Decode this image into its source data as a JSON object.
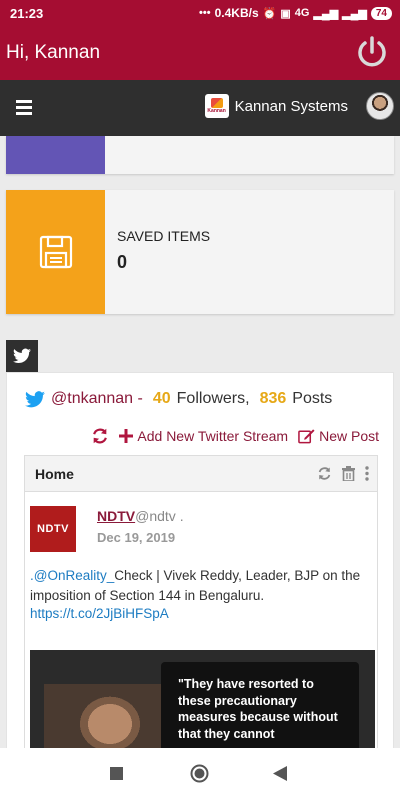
{
  "status_bar": {
    "time": "21:23",
    "net_speed": "0.4KB/s",
    "network": "4G",
    "battery": "74"
  },
  "app_bar": {
    "greeting": "Hi, Kannan",
    "power_icon": "power-icon"
  },
  "nav_bar": {
    "menu_icon": "hamburger-icon",
    "company_name": "Kannan Systems",
    "company_logo_text": "Kannan"
  },
  "saved_card": {
    "label": "SAVED ITEMS",
    "count": "0",
    "icon": "save-icon"
  },
  "twitter": {
    "handle": "@tnkannan -",
    "followers_count": "40",
    "followers_label": "Followers,",
    "posts_count": "836",
    "posts_label": "Posts",
    "add_stream_label": "Add New Twitter Stream",
    "new_post_label": "New Post",
    "stream": {
      "title": "Home",
      "tweet": {
        "avatar_text": "NDTV",
        "name": "NDTV",
        "username": "@ndtv .",
        "date": "Dec 19, 2019",
        "mention": ".@OnReality_",
        "text": "Check | Vivek Reddy, Leader, BJP on the imposition of Section 144 in Bengaluru.",
        "link": "https://t.co/2JjBiHFSpA",
        "media_quote": "\"They have resorted to these precautionary measures because without that they cannot"
      }
    }
  },
  "colors": {
    "header": "#a50d32",
    "navbar": "#2f2f2f",
    "saved_strip": "#f4a21a",
    "top_strip": "#6355b5"
  }
}
